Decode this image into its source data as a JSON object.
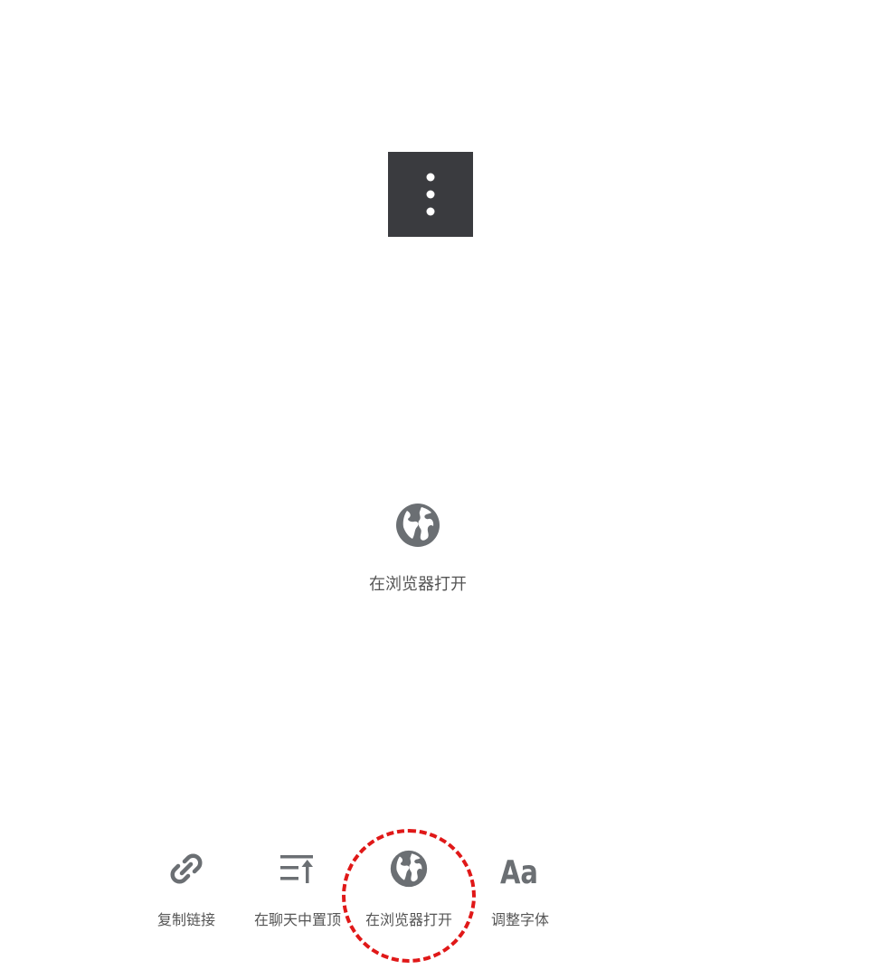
{
  "more_button": {
    "icon": "more-vertical-icon",
    "background": "#3a3b3f"
  },
  "featured_action": {
    "icon": "globe-icon",
    "label": "在浏览器打开"
  },
  "toolbar": {
    "items": [
      {
        "icon": "link-icon",
        "label": "复制链接"
      },
      {
        "icon": "pin-to-top-icon",
        "label": "在聊天中置顶"
      },
      {
        "icon": "globe-icon",
        "label": "在浏览器打开"
      },
      {
        "icon": "font-size-icon",
        "label": "调整字体"
      }
    ],
    "highlighted_item": "在浏览器打开",
    "highlight_color": "#e01818"
  },
  "colors": {
    "icon_gray": "#6b6f73",
    "text_gray": "#555555"
  }
}
